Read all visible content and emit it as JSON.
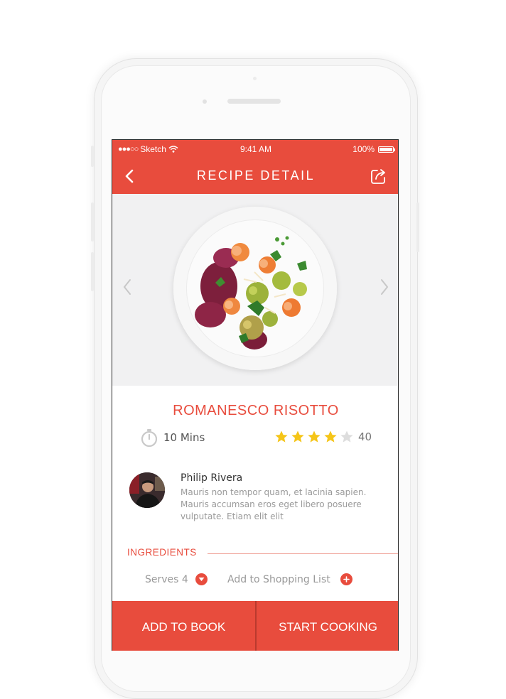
{
  "status_bar": {
    "carrier": "Sketch",
    "time": "9:41 AM",
    "battery": "100%"
  },
  "nav": {
    "title": "RECIPE DETAIL",
    "back_icon": "chevron-left-icon",
    "share_icon": "share-icon"
  },
  "recipe": {
    "title": "ROMANESCO RISOTTO",
    "time": "10 Mins",
    "rating_stars": 4,
    "rating_max": 5,
    "rating_count": "40"
  },
  "author": {
    "name": "Philip Rivera",
    "bio": "Mauris non tempor quam, et lacinia sapien. Mauris accumsan eros eget libero posuere vulputate. Etiam elit elit"
  },
  "ingredients": {
    "heading": "INGREDIENTS",
    "serves_label": "Serves 4",
    "shopping_label": "Add to Shopping List"
  },
  "footer": {
    "add_to_book": "ADD TO BOOK",
    "start_cooking": "START COOKING"
  },
  "colors": {
    "accent": "#e84c3d",
    "star_filled": "#f5c518",
    "star_empty": "#dddddd"
  }
}
